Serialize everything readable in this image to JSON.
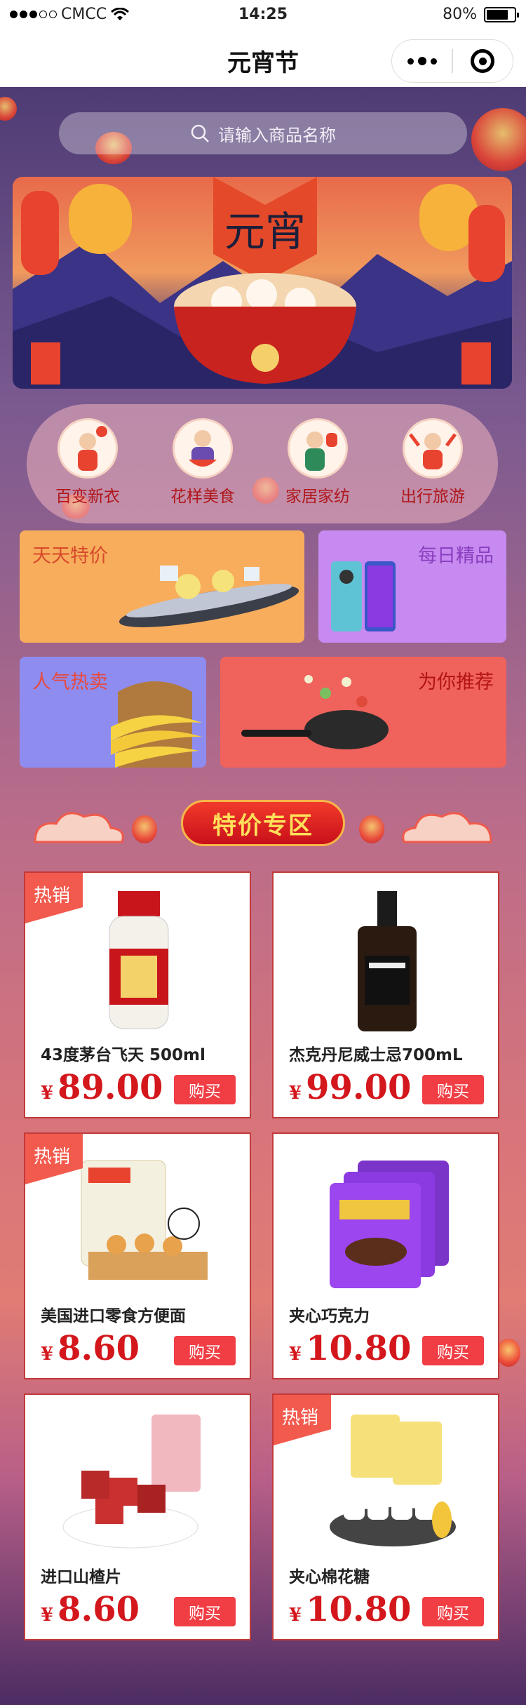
{
  "status": {
    "carrier": "CMCC",
    "time": "14:25",
    "battery": "80%",
    "battery_level": 0.8
  },
  "nav": {
    "title": "元宵节"
  },
  "search": {
    "placeholder": "请输入商品名称"
  },
  "banner": {
    "calligraphy": "元宵"
  },
  "categories": [
    {
      "label": "百变新衣",
      "icon": "kid-with-balloon-icon"
    },
    {
      "label": "花样美食",
      "icon": "kid-with-food-bowl-icon"
    },
    {
      "label": "家居家纺",
      "icon": "kid-with-lantern-icon"
    },
    {
      "label": "出行旅游",
      "icon": "kid-celebrating-icon"
    }
  ],
  "promos": {
    "daily_deals": "天天特价",
    "daily_picks": "每日精品",
    "popular": "人气热卖",
    "recommended": "为你推荐"
  },
  "section": {
    "title": "特价专区"
  },
  "products": [
    {
      "name": "43度茅台飞天 500ml",
      "currency": "¥",
      "price": "89.00",
      "badge": "热销",
      "buy": "购买"
    },
    {
      "name": "杰克丹尼威士忌700mL",
      "currency": "¥",
      "price": "99.00",
      "badge": "",
      "buy": "购买"
    },
    {
      "name": "美国进口零食方便面",
      "currency": "¥",
      "price": "8.60",
      "badge": "热销",
      "buy": "购买"
    },
    {
      "name": "夹心巧克力",
      "currency": "¥",
      "price": "10.80",
      "badge": "",
      "buy": "购买"
    },
    {
      "name": "进口山楂片",
      "currency": "¥",
      "price": "8.60",
      "badge": "",
      "buy": "购买"
    },
    {
      "name": "夹心棉花糖",
      "currency": "¥",
      "price": "10.80",
      "badge": "热销",
      "buy": "购买"
    }
  ],
  "colors": {
    "accent": "#d3171c",
    "buy_button": "#f03e44",
    "badge": "#f25a4e",
    "section_text": "#ffe05a"
  }
}
